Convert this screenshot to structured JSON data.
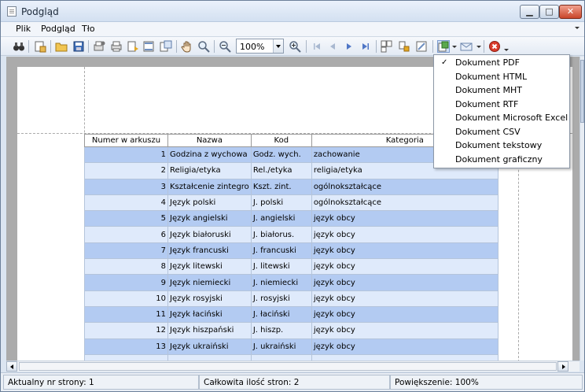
{
  "window": {
    "title": "Podgląd",
    "minimize_glyph": "▁",
    "maximize_glyph": "□",
    "close_glyph": "✕"
  },
  "menu": {
    "items": [
      "Plik",
      "Podgląd",
      "Tło"
    ]
  },
  "toolbar": {
    "icons": [
      "binoculars-icon",
      "page-setup-icon",
      "open-icon",
      "save-icon",
      "print-setup-icon",
      "print-icon",
      "quick-print-icon",
      "header-footer-icon",
      "scale-icon",
      "hand-tool-icon",
      "magnifier-icon",
      "zoom-out-icon",
      "zoom-in-icon",
      "first-page-icon",
      "previous-page-icon",
      "next-page-icon",
      "last-page-icon",
      "multiple-pages-icon",
      "color-icon",
      "watermark-icon",
      "export-document-icon",
      "send-email-icon",
      "exit-icon"
    ],
    "zoom_value": "100%"
  },
  "table": {
    "columns": [
      "Numer w arkuszu",
      "Nazwa",
      "Kod",
      "Kategoria"
    ],
    "rows": [
      {
        "num": "1",
        "name": "Godzina z wychowa",
        "code": "Godz. wych.",
        "category": "zachowanie"
      },
      {
        "num": "2",
        "name": "Religia/etyka",
        "code": "Rel./etyka",
        "category": "religia/etyka"
      },
      {
        "num": "3",
        "name": "Kształcenie zintegro",
        "code": "Kszt. zint.",
        "category": "ogólnokształcące"
      },
      {
        "num": "4",
        "name": "Język polski",
        "code": "J. polski",
        "category": "ogólnokształcące"
      },
      {
        "num": "5",
        "name": "Język angielski",
        "code": "J. angielski",
        "category": "język obcy"
      },
      {
        "num": "6",
        "name": "Język białoruski",
        "code": "J. białorus.",
        "category": "język obcy"
      },
      {
        "num": "7",
        "name": "Język francuski",
        "code": "J. francuski",
        "category": "język obcy"
      },
      {
        "num": "8",
        "name": "Język litewski",
        "code": "J. litewski",
        "category": "język obcy"
      },
      {
        "num": "9",
        "name": "Język niemiecki",
        "code": "J. niemiecki",
        "category": "język obcy"
      },
      {
        "num": "10",
        "name": "Język rosyjski",
        "code": "J. rosyjski",
        "category": "język obcy"
      },
      {
        "num": "11",
        "name": "Język łaciński",
        "code": "J. łaciński",
        "category": "język obcy"
      },
      {
        "num": "12",
        "name": "Język hiszpański",
        "code": "J. hiszp.",
        "category": "język obcy"
      },
      {
        "num": "13",
        "name": "Język ukraiński",
        "code": "J. ukraiński",
        "category": "język obcy"
      }
    ]
  },
  "export_menu": {
    "items": [
      {
        "label": "Dokument PDF",
        "checked": true
      },
      {
        "label": "Dokument HTML",
        "checked": false
      },
      {
        "label": "Dokument MHT",
        "checked": false
      },
      {
        "label": "Dokument RTF",
        "checked": false
      },
      {
        "label": "Dokument Microsoft Excel",
        "checked": false
      },
      {
        "label": "Dokument CSV",
        "checked": false
      },
      {
        "label": "Dokument tekstowy",
        "checked": false
      },
      {
        "label": "Dokument graficzny",
        "checked": false
      }
    ],
    "check_glyph": "✓"
  },
  "status": {
    "current_page": "Aktualny nr strony: 1",
    "total_pages": "Całkowita ilość stron: 2",
    "zoom": "Powiększenie: 100%"
  },
  "colors": {
    "row_odd": "#b3cbf2",
    "row_even": "#dfeafb",
    "preview_background": "#ababab"
  }
}
